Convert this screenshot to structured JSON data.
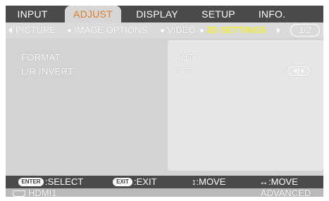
{
  "tabs": [
    "INPUT",
    "ADJUST",
    "DISPLAY",
    "SETUP",
    "INFO."
  ],
  "active_tab": "ADJUST",
  "subtabs": [
    "PICTURE",
    "IMAGE OPTIONS",
    "VIDEO",
    "3D SETTINGS"
  ],
  "active_subtab": "3D SETTINGS",
  "page_indicator": "1/2",
  "rows": [
    {
      "label": "FORMAT",
      "value": "AUTO"
    },
    {
      "label": "L/R INVERT",
      "value": "OFF"
    }
  ],
  "help": {
    "enter_key": "ENTER",
    "enter_text": ":SELECT",
    "exit_key": "EXIT",
    "exit_text": ":EXIT",
    "move_v": "↕:MOVE",
    "move_h": "↔:MOVE"
  },
  "source": {
    "input": "HDMI1",
    "mode": "ADVANCED"
  },
  "colors": {
    "tab_bar": "#4a4a4a",
    "active_tab_text": "#e07a28",
    "active_subtab_text": "#f1ea3a",
    "content_bg": "#d3d3d3",
    "value_panel_bg": "#e6e6e6"
  }
}
